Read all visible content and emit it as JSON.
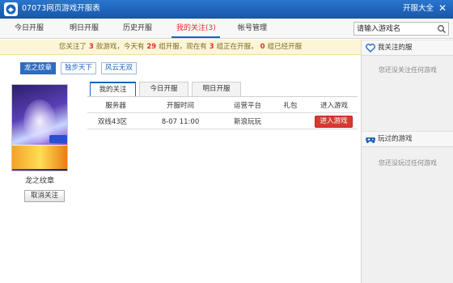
{
  "app": {
    "title": "07073网页游戏开服表",
    "open_all": "开服大全"
  },
  "nav": {
    "tabs": [
      {
        "label": "今日开服"
      },
      {
        "label": "明日开服"
      },
      {
        "label": "历史开服"
      },
      {
        "label": "我的关注(3)"
      },
      {
        "label": "帐号管理"
      }
    ],
    "active_index": 3
  },
  "search": {
    "placeholder": "请输入游戏名"
  },
  "notice": {
    "p1": "您关注了",
    "n1": "3",
    "p2": "款游戏，今天有",
    "n2": "29",
    "p3": "组开服，现在有",
    "n3": "3",
    "p4": "组正在开服，",
    "n4": "0",
    "p5": "组已经开服"
  },
  "filters": [
    {
      "label": "龙之纹章",
      "active": true
    },
    {
      "label": "独步天下",
      "active": false
    },
    {
      "label": "风云无双",
      "active": false
    }
  ],
  "game": {
    "name": "龙之纹章",
    "unfollow": "取消关注"
  },
  "subtabs": [
    {
      "label": "我的关注"
    },
    {
      "label": "今日开服"
    },
    {
      "label": "明日开服"
    }
  ],
  "table": {
    "headers": [
      "服务器",
      "开服时间",
      "运营平台",
      "礼包",
      "进入游戏"
    ],
    "rows": [
      {
        "server": "双线43区",
        "time": "8-07 11:00",
        "platform": "新浪玩玩",
        "gift": "",
        "enter": "进入游戏"
      }
    ]
  },
  "sidebar": {
    "followed": {
      "title": "我关注的服",
      "empty": "您还没关注任何游戏"
    },
    "played": {
      "title": "玩过的游戏",
      "empty": "您还没玩过任何游戏"
    }
  },
  "colors": {
    "brand_blue": "#1c63bb",
    "accent_red": "#d93a30",
    "notice_bg": "#fdf6d6"
  }
}
